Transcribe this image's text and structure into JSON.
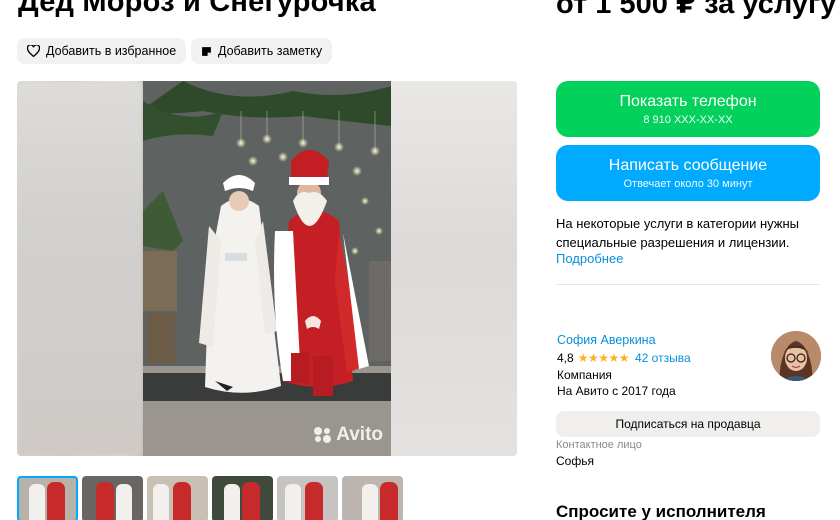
{
  "listing": {
    "title": "Дед Мороз и Снегурочка",
    "price": "от 1 500 ₽ за услугу"
  },
  "actions": {
    "favorite_label": "Добавить в избранное",
    "note_label": "Добавить заметку"
  },
  "gallery": {
    "watermark": "Avito",
    "thumbnail_count": 6,
    "active_index": 0
  },
  "contact_buttons": {
    "phone_label": "Показать телефон",
    "phone_masked": "8 910 XXX-XX-XX",
    "message_label": "Написать сообщение",
    "message_sub": "Отвечает около 30 минут"
  },
  "notice": {
    "text": "На некоторые услуги в категории нужны специальные разрешения и лицензии.",
    "link": "Подробнее"
  },
  "seller": {
    "name": "София Аверкина",
    "rating": "4,8",
    "stars": "★★★★★",
    "reviews": "42 отзыва",
    "type": "Компания",
    "since": "На Авито с 2017 года",
    "subscribe_label": "Подписаться на продавца",
    "contact_label": "Контактное лицо",
    "contact_name": "Софья"
  },
  "ask_section": {
    "title": "Спросите у исполнителя"
  },
  "colors": {
    "phone_button": "#02d15c",
    "message_button": "#00aaff",
    "link": "#0a8fd9",
    "star": "#ffb021"
  }
}
